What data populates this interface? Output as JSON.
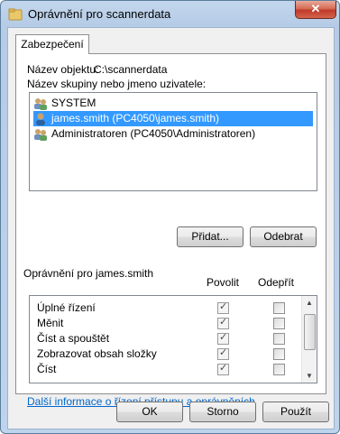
{
  "window": {
    "title": "Oprávnění pro scannerdata",
    "close_symbol": "✕"
  },
  "tabs": [
    {
      "label": "Zabezpečení"
    }
  ],
  "object": {
    "label": "Název objektu:",
    "value": "C:\\scannerdata"
  },
  "groups": {
    "label": "Název skupiny nebo jmeno uzivatele:",
    "items": [
      {
        "label": "SYSTEM",
        "icon": "group-icon",
        "selected": false
      },
      {
        "label": "james.smith (PC4050\\james.smith)",
        "icon": "user-icon",
        "selected": true
      },
      {
        "label": "Administratoren (PC4050\\Administratoren)",
        "icon": "group-icon",
        "selected": false
      }
    ]
  },
  "buttons": {
    "add": "Přidat...",
    "remove": "Odebrat",
    "ok": "OK",
    "cancel": "Storno",
    "apply": "Použít"
  },
  "permissions": {
    "label": "Oprávnění pro james.smith",
    "allow_header": "Povolit",
    "deny_header": "Odepřít",
    "rows": [
      {
        "name": "Úplné řízení",
        "allow": true,
        "deny": false
      },
      {
        "name": "Měnit",
        "allow": true,
        "deny": false
      },
      {
        "name": "Číst a spouštět",
        "allow": true,
        "deny": false
      },
      {
        "name": "Zobrazovat obsah složky",
        "allow": true,
        "deny": false
      },
      {
        "name": "Číst",
        "allow": true,
        "deny": false
      }
    ]
  },
  "link": "Další informace o řízení přístupu a oprávněních",
  "colors": {
    "selection": "#3399ff",
    "link": "#0066cc",
    "close": "#c0392b"
  }
}
